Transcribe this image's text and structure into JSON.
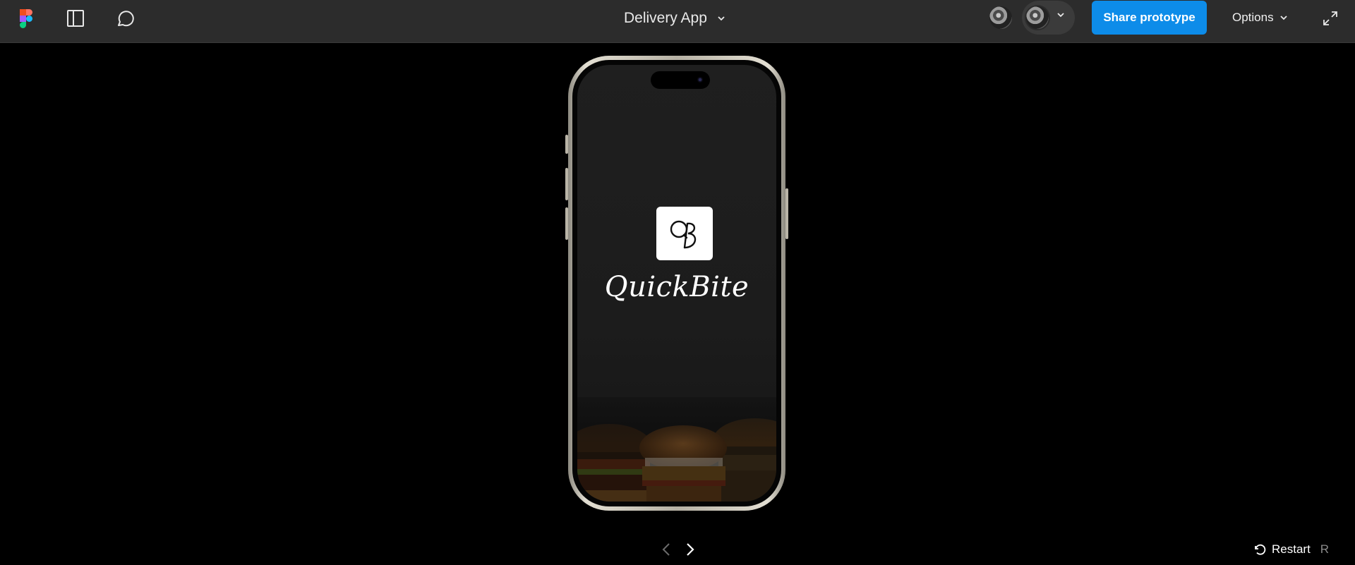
{
  "toolbar": {
    "file_title": "Delivery App",
    "share_label": "Share prototype",
    "options_label": "Options",
    "icons": [
      "figma-logo-icon",
      "sidebar-icon",
      "comment-icon",
      "chevron-down-icon",
      "expand-icon"
    ],
    "accent_color": "#0d8ce9"
  },
  "prototype": {
    "app_name": "QuickBite",
    "logo_text": "QB",
    "screen_background": "#1c1c1c"
  },
  "footer": {
    "restart_label": "Restart",
    "restart_shortcut": "R",
    "icons": [
      "chevron-left-icon",
      "chevron-right-icon",
      "restart-icon"
    ]
  }
}
